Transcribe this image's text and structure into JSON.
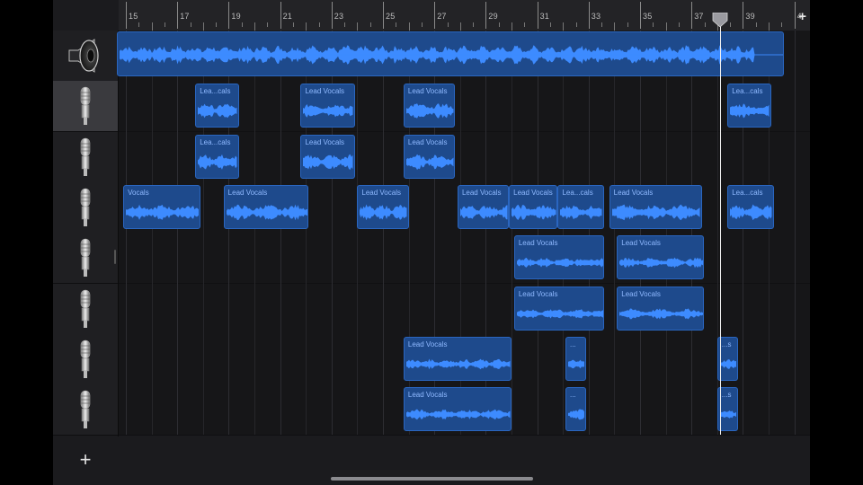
{
  "ruler": {
    "bars": [
      "15",
      "17",
      "19",
      "21",
      "23",
      "25",
      "27",
      "29",
      "31",
      "33",
      "35",
      "37",
      "39",
      "4"
    ],
    "add_label": "+"
  },
  "tracks": [
    {
      "icon": "speaker-icon",
      "selected": false
    },
    {
      "icon": "microphone-icon",
      "selected": true
    },
    {
      "icon": "microphone-icon",
      "selected": false
    },
    {
      "icon": "microphone-icon",
      "selected": false
    },
    {
      "icon": "microphone-icon",
      "selected": false
    },
    {
      "icon": "microphone-icon",
      "selected": false
    },
    {
      "icon": "microphone-icon",
      "selected": false
    },
    {
      "icon": "microphone-icon",
      "selected": false
    }
  ],
  "add_track_label": "+",
  "regions": [
    {
      "track": 0,
      "start": 14.0,
      "end": 40.6,
      "label": ""
    },
    {
      "track": 1,
      "start": 17.7,
      "end": 19.4,
      "label": "Lea...cals"
    },
    {
      "track": 1,
      "start": 21.8,
      "end": 23.9,
      "label": "Lead Vocals"
    },
    {
      "track": 1,
      "start": 25.8,
      "end": 27.8,
      "label": "Lead Vocals"
    },
    {
      "track": 1,
      "start": 38.4,
      "end": 40.1,
      "label": "Lea...cals"
    },
    {
      "track": 2,
      "start": 17.7,
      "end": 19.4,
      "label": "Lea...cals"
    },
    {
      "track": 2,
      "start": 21.8,
      "end": 23.9,
      "label": "Lead Vocals"
    },
    {
      "track": 2,
      "start": 25.8,
      "end": 27.8,
      "label": "Lead Vocals"
    },
    {
      "track": 3,
      "start": 14.9,
      "end": 17.9,
      "label": "Vocals"
    },
    {
      "track": 3,
      "start": 18.8,
      "end": 22.1,
      "label": "Lead Vocals"
    },
    {
      "track": 3,
      "start": 24.0,
      "end": 26.0,
      "label": "Lead Vocals"
    },
    {
      "track": 3,
      "start": 27.9,
      "end": 29.9,
      "label": "Lead Vocals"
    },
    {
      "track": 3,
      "start": 29.9,
      "end": 31.8,
      "label": "Lead Vocals"
    },
    {
      "track": 3,
      "start": 31.8,
      "end": 33.6,
      "label": "Lea...cals"
    },
    {
      "track": 3,
      "start": 33.8,
      "end": 37.4,
      "label": "Lead Vocals"
    },
    {
      "track": 3,
      "start": 38.4,
      "end": 40.2,
      "label": "Lea...cals"
    },
    {
      "track": 4,
      "start": 30.1,
      "end": 33.6,
      "label": "Lead Vocals"
    },
    {
      "track": 4,
      "start": 34.1,
      "end": 37.5,
      "label": "Lead Vocals"
    },
    {
      "track": 5,
      "start": 30.1,
      "end": 33.6,
      "label": "Lead Vocals"
    },
    {
      "track": 5,
      "start": 34.1,
      "end": 37.5,
      "label": "Lead Vocals"
    },
    {
      "track": 6,
      "start": 25.8,
      "end": 30.0,
      "label": "Lead Vocals"
    },
    {
      "track": 6,
      "start": 32.1,
      "end": 32.9,
      "label": "..."
    },
    {
      "track": 6,
      "start": 38.0,
      "end": 38.8,
      "label": "...s"
    },
    {
      "track": 7,
      "start": 25.8,
      "end": 30.0,
      "label": "Lead Vocals"
    },
    {
      "track": 7,
      "start": 32.1,
      "end": 32.9,
      "label": "..."
    },
    {
      "track": 7,
      "start": 38.0,
      "end": 38.8,
      "label": "...s"
    }
  ],
  "playhead_bar": 38.1,
  "colors": {
    "region_fill": "#1e4a8c",
    "region_border": "#2a66c0",
    "waveform": "#3d8bff",
    "region_label": "#8fb9ff",
    "playhead": "#f0f0f0"
  }
}
